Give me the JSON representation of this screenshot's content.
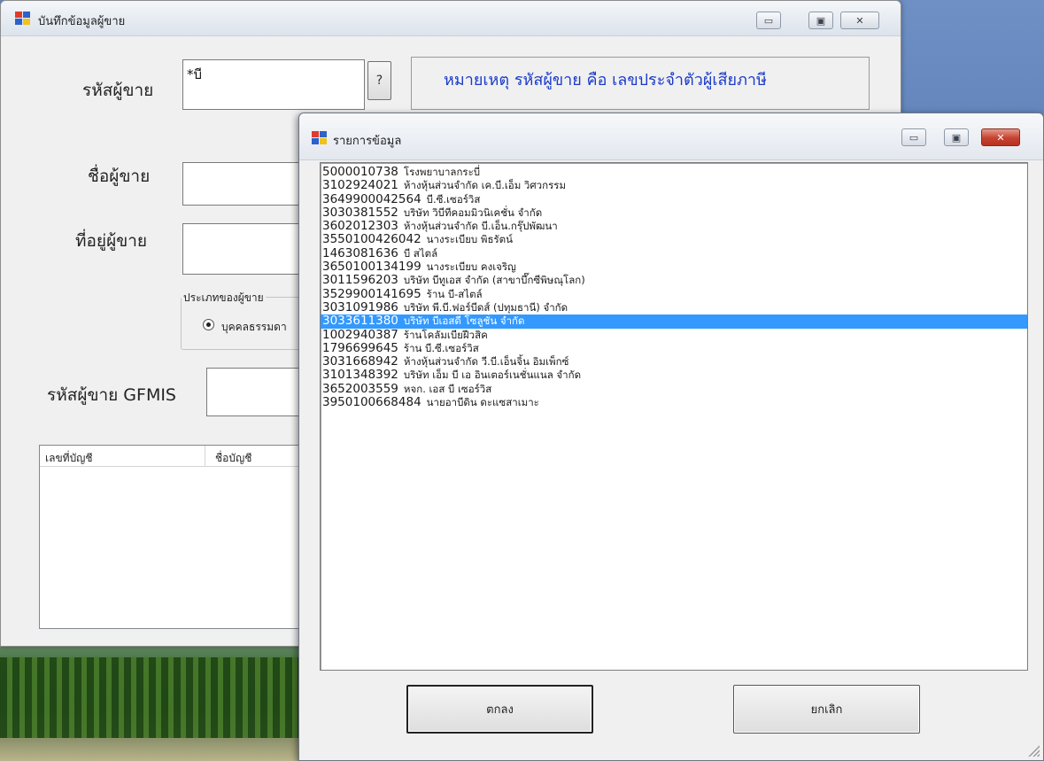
{
  "vendor_window": {
    "title": "บันทึกข้อมูลผู้ขาย",
    "vendor_code_label": "รหัสผู้ขาย",
    "vendor_code_value": "*บี",
    "lookup_button": "?",
    "note": "หมายเหตุ รหัสผู้ขาย คือ เลขประจำตัวผู้เสียภาษี",
    "vendor_name_label": "ชื่อผู้ขาย",
    "vendor_address_label": "ที่อยู่ผู้ขาย",
    "vendor_type_group": "ประเภทของผู้ขาย",
    "vendor_type_option": "บุคคลธรรมดา",
    "gfmis_label": "รหัสผู้ขาย GFMIS",
    "list_columns": [
      "เลขที่บัญชี",
      "ชื่อบัญชี"
    ]
  },
  "list_window": {
    "title": "รายการข้อมูล",
    "selected_index": 11,
    "items": [
      {
        "code": "5000010738",
        "name": "โรงพยาบาลกระบี่"
      },
      {
        "code": "3102924021",
        "name": "ห้างหุ้นส่วนจำกัด เค.บี.เอ็ม วิศวกรรม"
      },
      {
        "code": "3649900042564",
        "name": "บี.ซี.เซอร์วิส"
      },
      {
        "code": "3030381552",
        "name": "บริษัท วิบีทีคอมมิวนิเคชั่น จำกัด"
      },
      {
        "code": "3602012303",
        "name": "ห้างหุ้นส่วนจำกัด บี.เอ็น.กรุ๊ปพัฒนา"
      },
      {
        "code": "3550100426042",
        "name": "นางระเบียบ พิธรัตน์"
      },
      {
        "code": "1463081636",
        "name": "บี สไตล์"
      },
      {
        "code": "3650100134199",
        "name": "นางระเบียบ คงเจริญ"
      },
      {
        "code": "3011596203",
        "name": "บริษัท บีทูเอส จำกัด (สาขาบึ๊กซีพิษณุโลก)"
      },
      {
        "code": "3529900141695",
        "name": "ร้าน บี-สไตล์"
      },
      {
        "code": "3031091986",
        "name": "บริษัท พี.บี.ฟอร์บีดส์ (ปทุมธานี) จำกัด"
      },
      {
        "code": "3033611380",
        "name": "บริษัท บีเอสดี โซลูชั่น จำกัด"
      },
      {
        "code": "1002940387",
        "name": "ร้านโคลัมเบียฝีวสิค"
      },
      {
        "code": "1796699645",
        "name": "ร้าน บี.ซี.เซอร์วิส"
      },
      {
        "code": "3031668942",
        "name": "ห้างหุ้นส่วนจำกัด วี.บี.เอ็นจิ้น อิมเพ็กซ์"
      },
      {
        "code": "3101348392",
        "name": "บริษัท เอ็ม บี เอ อินเตอร์เนชั่นแนล จำกัด"
      },
      {
        "code": "3652003559",
        "name": "หจก. เอส บี เซอร์วิส"
      },
      {
        "code": "3950100668484",
        "name": "นายอาบีดิน ดะแซสาเมาะ"
      }
    ],
    "ok_button": "ตกลง",
    "cancel_button": "ยกเลิก"
  },
  "colors": {
    "selection": "#3399ff",
    "note_text": "#1a3ac9",
    "close_button": "#c54230"
  }
}
